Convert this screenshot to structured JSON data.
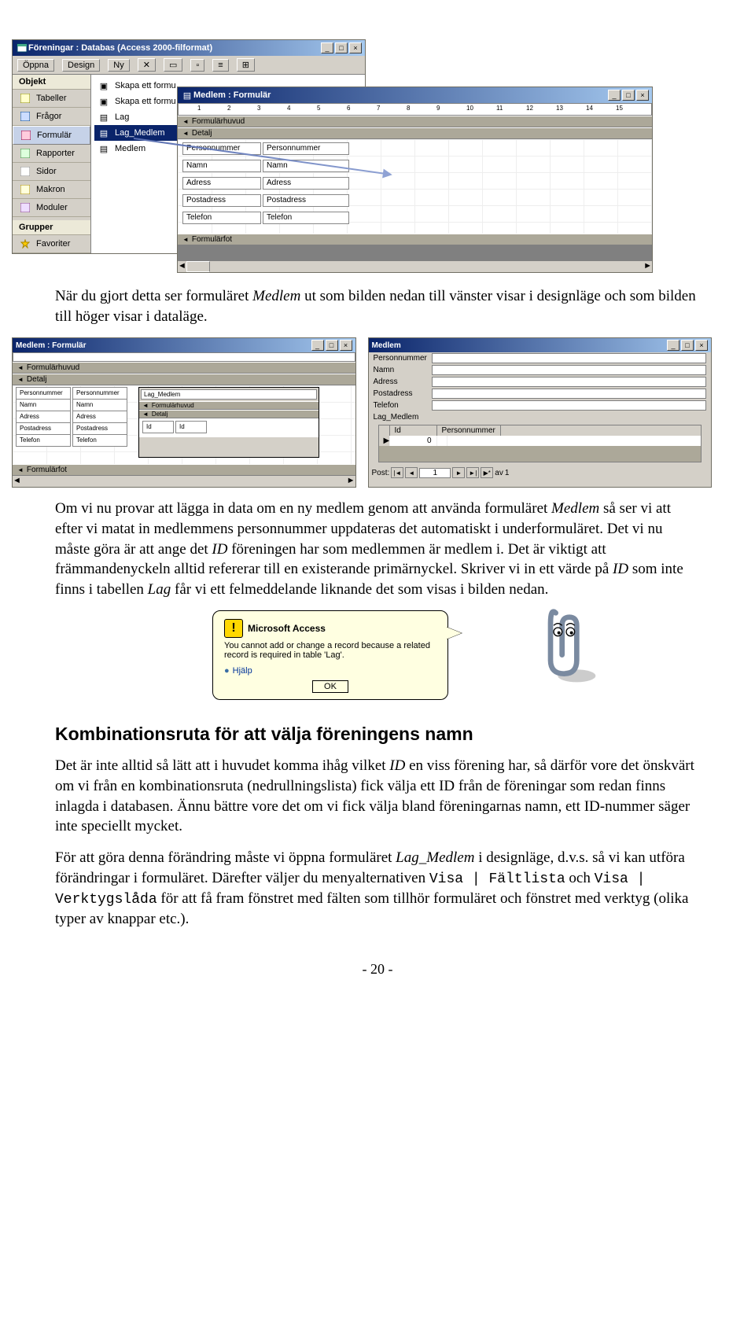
{
  "dbWindow": {
    "title": "Föreningar : Databas (Access 2000-filformat)",
    "toolbar": [
      "Öppna",
      "Design",
      "Ny"
    ],
    "sidebarHeader": "Objekt",
    "sidebar": [
      {
        "label": "Tabeller"
      },
      {
        "label": "Frågor"
      },
      {
        "label": "Formulär",
        "selected": true
      },
      {
        "label": "Rapporter"
      },
      {
        "label": "Sidor"
      },
      {
        "label": "Makron"
      },
      {
        "label": "Moduler"
      }
    ],
    "groupsHeader": "Grupper",
    "groups": [
      {
        "label": "Favoriter"
      }
    ],
    "items": [
      {
        "label": "Skapa ett formu"
      },
      {
        "label": "Skapa ett formu"
      },
      {
        "label": "Lag"
      },
      {
        "label": "Lag_Medlem",
        "selected": true
      },
      {
        "label": "Medlem"
      }
    ]
  },
  "formWindow": {
    "title": "Medlem : Formulär",
    "bands": {
      "header": "Formulärhuvud",
      "detail": "Detalj",
      "footer": "Formulärfot"
    },
    "fields": [
      {
        "label": "Personnummer",
        "bind": "Personnummer"
      },
      {
        "label": "Namn",
        "bind": "Namn"
      },
      {
        "label": "Adress",
        "bind": "Adress"
      },
      {
        "label": "Postadress",
        "bind": "Postadress"
      },
      {
        "label": "Telefon",
        "bind": "Telefon"
      }
    ],
    "rulerNumbers": [
      "1",
      "2",
      "3",
      "4",
      "5",
      "6",
      "7",
      "8",
      "9",
      "10",
      "11",
      "12",
      "13",
      "14",
      "15"
    ]
  },
  "para1_a": "När du gjort detta ser formuläret ",
  "para1_em": "Medlem",
  "para1_b": " ut som bilden nedan till vänster visar i designläge och som bilden till höger visar i dataläge.",
  "leftSmall": {
    "title": "Medlem : Formulär",
    "bands": {
      "header": "Formulärhuvud",
      "detail": "Detalj",
      "footer": "Formulärfot"
    },
    "mainFields": [
      {
        "label": "Personnummer",
        "bind": "Personnummer"
      },
      {
        "label": "Namn",
        "bind": "Namn"
      },
      {
        "label": "Adress",
        "bind": "Adress"
      },
      {
        "label": "Postadress",
        "bind": "Postadress"
      },
      {
        "label": "Telefon",
        "bind": "Telefon"
      }
    ],
    "subTitle": "Lag_Medlem",
    "subFields": [
      {
        "label": "Id",
        "bind": "Id"
      }
    ]
  },
  "rightSmall": {
    "title": "Medlem",
    "dataLabels": [
      "Personnummer",
      "Namn",
      "Adress",
      "Postadress",
      "Telefon"
    ],
    "sub": {
      "title": "Lag_Medlem",
      "cols": [
        "Id",
        "Personnummer"
      ],
      "row": [
        "0",
        ""
      ]
    },
    "navLabel": "Post:",
    "navOf": "av",
    "navTotal": "1"
  },
  "para2": "Om vi nu provar att lägga in data om en ny medlem genom att använda formuläret <em>Medlem</em> så ser vi att efter vi matat in medlemmens personnummer uppdateras det automatiskt i underformuläret. Det vi nu måste göra är att ange det <em>ID</em> föreningen har som medlemmen är medlem i. Det är viktigt att främmandenyckeln alltid refererar till en existerande primärnyckel. Skriver vi in ett värde på <em>ID</em> som inte finns i tabellen <em>Lag</em> får vi ett felmeddelande liknande det som visas i bilden nedan.",
  "assistant": {
    "product": "Microsoft Access",
    "message": "You cannot add or change a record because a related record is required in table 'Lag'.",
    "help": "Hjälp",
    "ok": "OK"
  },
  "section": "Kombinationsruta för att välja föreningens namn",
  "para3": "Det är inte alltid så lätt att i huvudet komma ihåg vilket <em>ID</em> en viss förening har, så därför vore det önskvärt om vi från en kombinationsruta (nedrullningslista) fick välja ett ID från de föreningar som redan finns inlagda i databasen. Ännu bättre vore det om vi fick välja bland föreningarnas namn, ett ID-nummer säger inte speciellt mycket.",
  "para4_a": "För att göra denna förändring måste vi öppna formuläret ",
  "para4_em": "Lag_Medlem",
  "para4_b": " i designläge, d.v.s. så vi kan utföra förändringar i formuläret. Därefter väljer du menyalternativen ",
  "para4_m1": "Visa | Fältlista",
  "para4_c": " och ",
  "para4_m2": "Visa | Verktygslåda",
  "para4_d": " för att få fram fönstret med fälten som tillhör formuläret och fönstret med verktyg (olika typer av knappar etc.).",
  "pagenum": "- 20 -"
}
